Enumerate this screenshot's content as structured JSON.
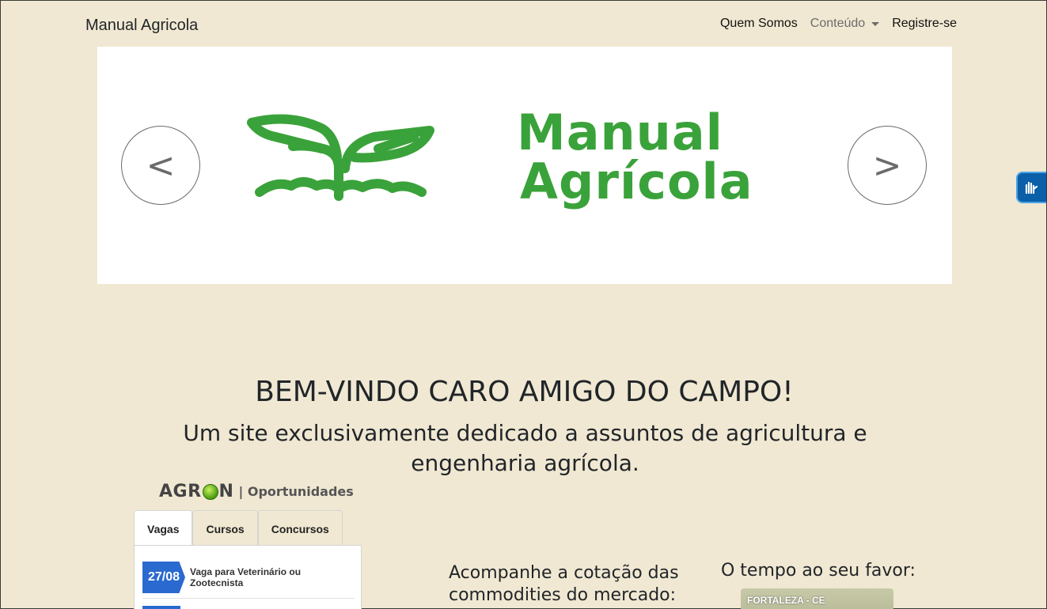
{
  "navbar": {
    "brand": "Manual Agricola",
    "items": [
      {
        "label": "Quem Somos"
      },
      {
        "label": "Conteúdo"
      },
      {
        "label": "Registre-se"
      }
    ]
  },
  "carousel": {
    "prev_label": "<",
    "next_label": ">",
    "logo_line1": "Manual",
    "logo_line2": "Agrícola",
    "logo_color": "#3aa23a"
  },
  "hero": {
    "title": "BEM-VINDO CARO AMIGO DO CAMPO!",
    "subtitle": "Um site exclusivamente dedicado a assuntos de agricultura e engenharia agrícola."
  },
  "agron": {
    "logo": "AGRON",
    "subtitle": "| Oportunidades",
    "tabs": [
      {
        "label": "Vagas"
      },
      {
        "label": "Cursos"
      },
      {
        "label": "Concursos"
      }
    ],
    "jobs": [
      {
        "date": "27/08",
        "title": "Vaga para Veterinário ou Zootecnista"
      }
    ]
  },
  "commodities": {
    "title": "Acompanhe a cotação das commodities do mercado:"
  },
  "weather": {
    "title": "O tempo ao seu favor:",
    "city": "FORTALEZA - CE"
  },
  "colors": {
    "background": "#f0e8d2",
    "accent_blue": "#2a6ad0"
  }
}
